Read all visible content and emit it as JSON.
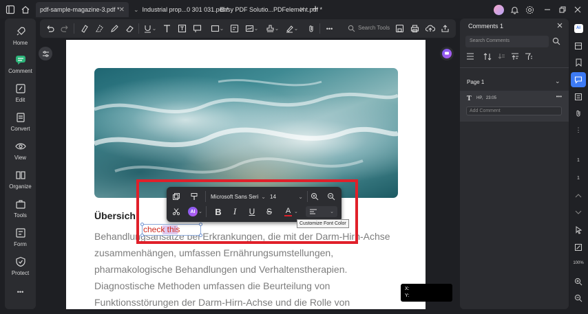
{
  "tabs": [
    {
      "label": "pdf-sample-magazine-3.pdf *",
      "close": "✕"
    },
    {
      "label": "Industrial  prop...0 301 031.pdf *",
      "close": ""
    },
    {
      "label": "Easy PDF Solutio...PDFelement.pdf *",
      "close": "✕"
    }
  ],
  "leftnav": {
    "items": [
      {
        "label": "Home",
        "icon": "rocket-icon"
      },
      {
        "label": "Comment",
        "icon": "comment-icon"
      },
      {
        "label": "Edit",
        "icon": "edit-icon"
      },
      {
        "label": "Convert",
        "icon": "convert-icon"
      },
      {
        "label": "View",
        "icon": "eye-icon"
      },
      {
        "label": "Organize",
        "icon": "organize-icon"
      },
      {
        "label": "Tools",
        "icon": "toolbox-icon"
      },
      {
        "label": "Form",
        "icon": "form-icon"
      },
      {
        "label": "Protect",
        "icon": "shield-icon"
      }
    ],
    "more": "•••"
  },
  "toolbar": {
    "search_placeholder": "Search Tools",
    "more": "•••"
  },
  "document": {
    "heading": "Übersich",
    "body_lines": [
      "Behandlungsansätze bei Erkrankungen, die mit der Darm-Hirn-Achse",
      "zusammenhängen, umfassen Ernährungsumstellungen,",
      "pharmakologische Behandlungen und Verhaltenstherapien.",
      "Diagnostische Methoden umfassen die Beurteilung von",
      "Funktionsstörungen der Darm-Hirn-Achse und die Rolle von"
    ],
    "annotation_text": "check this"
  },
  "format_bar": {
    "font_name": "Microsoft Sans Seri",
    "font_size": "14",
    "tooltip": "Customize Font Color",
    "ai_label": "AI"
  },
  "coords": {
    "x_label": "X:",
    "y_label": "Y:"
  },
  "comments_panel": {
    "title": "Comments 1",
    "search_placeholder": "Search Comments",
    "page_label": "Page 1",
    "comment_author": "HP,",
    "comment_time": "23:05",
    "add_comment_placeholder": "Add Comment",
    "more": "•••"
  },
  "right_strip": {
    "page_current": "1",
    "page_total": "1",
    "zoom": "100%"
  },
  "colors": {
    "accent_blue": "#3d7bf5",
    "comment_green": "#2db57a",
    "highlight_red": "#e0202a",
    "annotation_red": "#d0281c"
  }
}
